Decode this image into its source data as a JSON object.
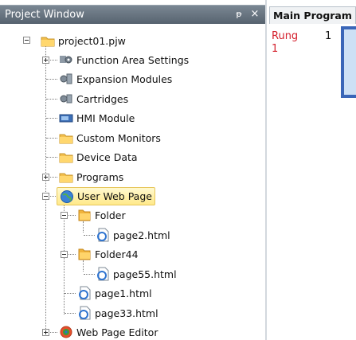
{
  "project_window": {
    "title": "Project Window",
    "pin_glyph": "ᵽ",
    "close_glyph": "×",
    "tree": {
      "root": "project01.pjw",
      "items": [
        {
          "label": "Function Area Settings"
        },
        {
          "label": "Expansion Modules"
        },
        {
          "label": "Cartridges"
        },
        {
          "label": "HMI Module"
        },
        {
          "label": "Custom Monitors"
        },
        {
          "label": "Device Data"
        },
        {
          "label": "Programs"
        },
        {
          "label": "User Web Page"
        },
        {
          "label": "Web Page Editor"
        }
      ],
      "web_children": [
        {
          "label": "Folder",
          "children": [
            {
              "label": "page2.html"
            }
          ]
        },
        {
          "label": "Folder44",
          "children": [
            {
              "label": "page55.html"
            }
          ]
        },
        {
          "label": "page1.html"
        },
        {
          "label": "page33.html"
        }
      ]
    }
  },
  "editor": {
    "tab_label": "Main Program",
    "rung_word": "Rung",
    "rung_number": "1",
    "rung_index": "1",
    "colors": {
      "rung_text": "#d4202d",
      "rung_frame": "#3a66b8",
      "selection": "#ffe98a"
    }
  }
}
